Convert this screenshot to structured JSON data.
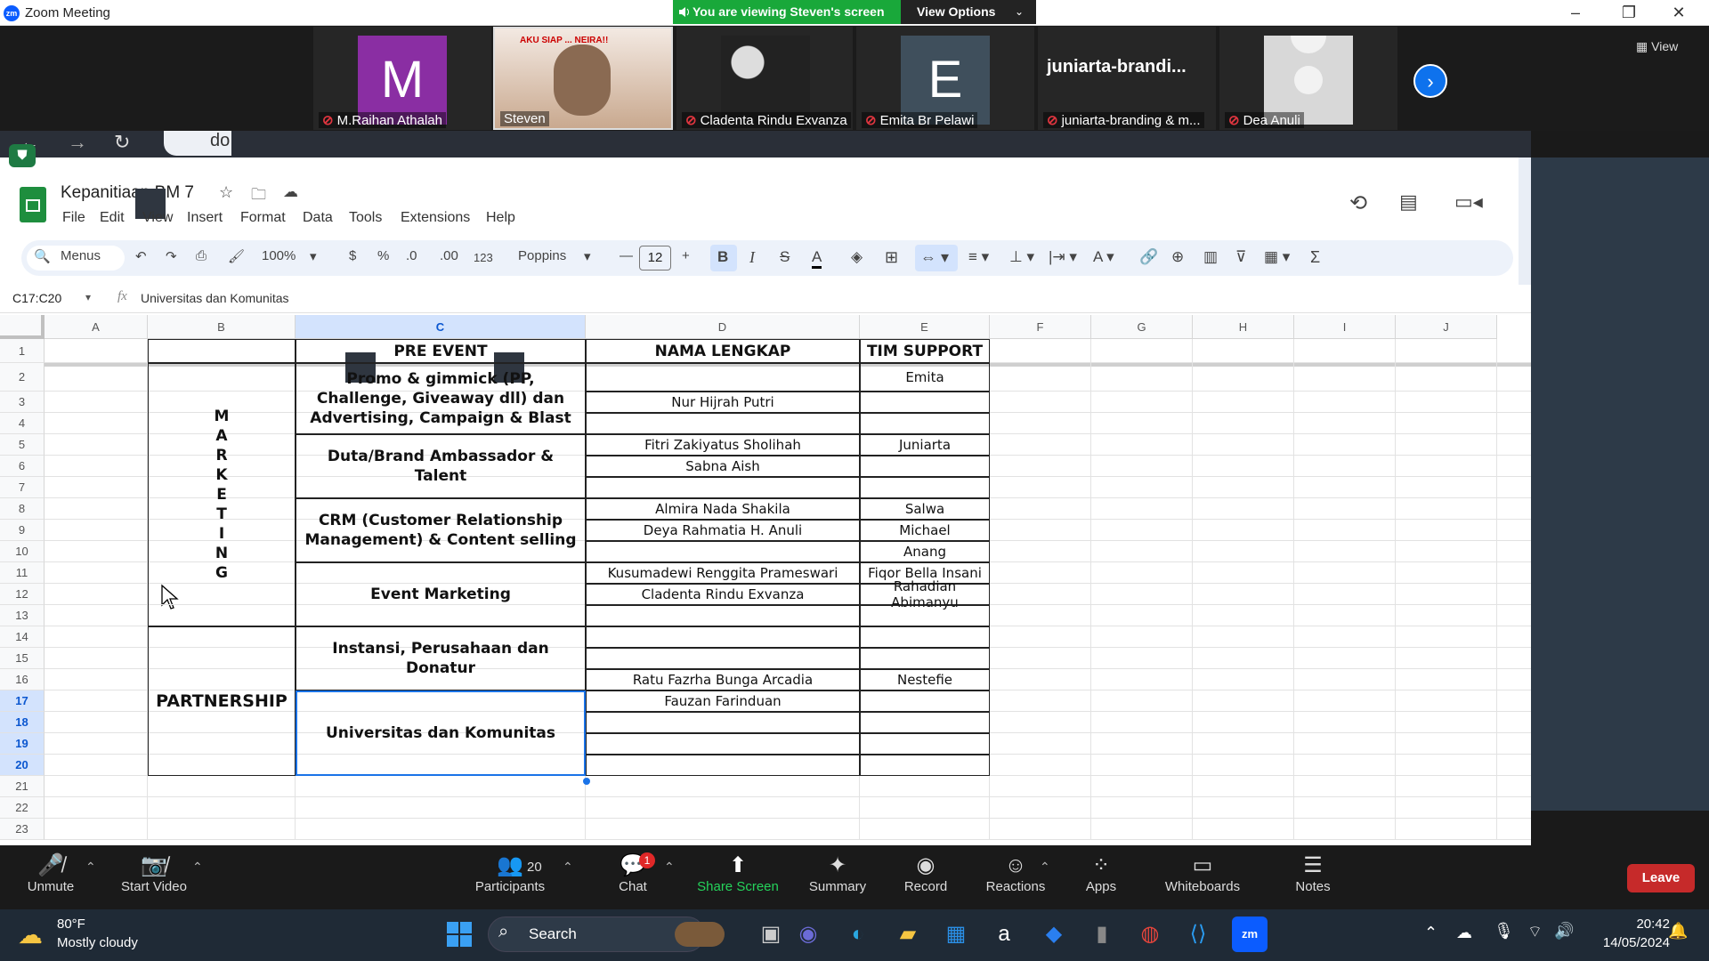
{
  "zoom": {
    "app_title": "Zoom Meeting",
    "viewing_banner": "You are viewing Steven's screen",
    "view_options": "View Options",
    "window_controls": {
      "minimize": "–",
      "maximize": "❐",
      "close": "✕"
    },
    "strip_view_label": "View",
    "participants": [
      {
        "name": "M.Raihan Athalah",
        "initial": "M",
        "muted": true,
        "color": "#8a2ea3"
      },
      {
        "name": "Steven",
        "initial": "",
        "muted": false,
        "color": "#8b7d6b"
      },
      {
        "name": "Cladenta Rindu Exvanza",
        "initial": "",
        "muted": true,
        "color": "#333333"
      },
      {
        "name": "Emita Br Pelawi",
        "initial": "E",
        "muted": true,
        "color": "#3f4f5c"
      },
      {
        "name": "juniarta-branding & m...",
        "initial": "",
        "muted": true,
        "color": "#262626",
        "big_label": "juniarta-brandi..."
      },
      {
        "name": "Dea Anuli",
        "initial": "",
        "muted": true,
        "color": "#d8d8d8"
      }
    ],
    "steven_overlay_text": "AKU SIAP ... NEIRA!!",
    "toolbar": [
      {
        "label": "Unmute",
        "icon": "mic-off-icon"
      },
      {
        "label": "Start Video",
        "icon": "video-off-icon"
      },
      {
        "label": "Participants",
        "icon": "participants-icon",
        "count": "20"
      },
      {
        "label": "Chat",
        "icon": "chat-icon",
        "badge": "1"
      },
      {
        "label": "Share Screen",
        "icon": "share-screen-icon"
      },
      {
        "label": "Summary",
        "icon": "summary-icon"
      },
      {
        "label": "Record",
        "icon": "record-icon"
      },
      {
        "label": "Reactions",
        "icon": "reactions-icon"
      },
      {
        "label": "Apps",
        "icon": "apps-icon"
      },
      {
        "label": "Whiteboards",
        "icon": "whiteboards-icon"
      },
      {
        "label": "Notes",
        "icon": "notes-icon"
      }
    ],
    "leave": "Leave"
  },
  "browser": {
    "url_fragment": "do"
  },
  "sheets": {
    "doc_title": "Kepanitiaan BM 7",
    "menus": [
      "File",
      "Edit",
      "View",
      "Insert",
      "Format",
      "Data",
      "Tools",
      "Extensions",
      "Help"
    ],
    "toolbar": {
      "search": "Menus",
      "zoom": "100%",
      "currency": "$",
      "percent": "%",
      "dec_minus": ".0",
      "dec_plus": ".00",
      "number_format": "123",
      "font": "Poppins",
      "font_size": "12"
    },
    "name_box": "C17:C20",
    "formula": "Universitas dan Komunitas",
    "columns": [
      "A",
      "B",
      "C",
      "D",
      "E",
      "F",
      "G",
      "H",
      "I",
      "J"
    ],
    "rows": [
      "1",
      "2",
      "3",
      "4",
      "5",
      "6",
      "7",
      "8",
      "9",
      "10",
      "11",
      "12",
      "13",
      "14",
      "15",
      "16",
      "17",
      "18",
      "19",
      "20",
      "21",
      "22",
      "23"
    ],
    "headers": {
      "c": "PRE EVENT",
      "d": "NAMA LENGKAP",
      "e": "TIM SUPPORT"
    },
    "groups": {
      "marketing": [
        "M",
        "A",
        "R",
        "K",
        "E",
        "T",
        "I",
        "N",
        "G"
      ],
      "partnership": "PARTNERSHIP"
    },
    "categories": [
      "Promo & gimmick (PP, Challenge, Giveaway dll) dan Advertising, Campaign & Blast",
      "Duta/Brand Ambassador & Talent",
      "CRM (Customer Relationship Management) & Content selling",
      "Event Marketing",
      "Instansi, Perusahaan dan Donatur",
      "Universitas dan Komunitas"
    ],
    "names_d": {
      "3": "Nur Hijrah Putri",
      "5": "Fitri Zakiyatus Sholihah",
      "6": "Sabna Aish",
      "8": "Almira Nada Shakila",
      "9": "Deya Rahmatia H. Anuli",
      "11": "Kusumadewi Renggita Prameswari",
      "12": "Cladenta Rindu Exvanza",
      "16": "Ratu Fazrha Bunga Arcadia",
      "17": "Fauzan Farinduan"
    },
    "names_e": {
      "2": "Emita",
      "5": "Juniarta",
      "8": "Salwa",
      "9": "Michael",
      "10": "Anang",
      "11": "Fiqor Bella Insani",
      "12": "Rahadian Abimanyu",
      "16": "Nestefie"
    }
  },
  "taskbar": {
    "weather_temp": "80°F",
    "weather_desc": "Mostly cloudy",
    "search": "Search",
    "time": "20:42",
    "date": "14/05/2024"
  }
}
